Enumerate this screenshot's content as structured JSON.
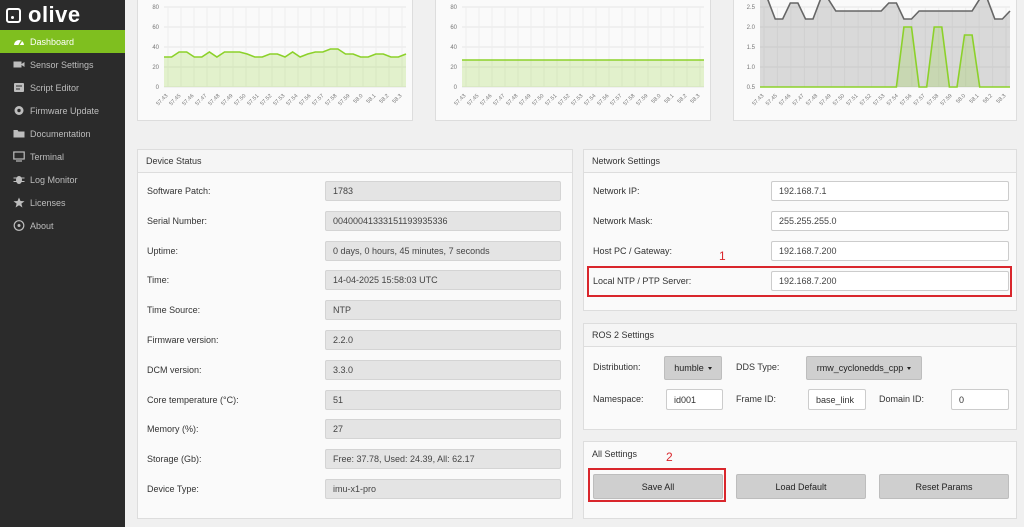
{
  "app": {
    "name": "olive"
  },
  "sidebar": {
    "items": [
      {
        "label": "Dashboard",
        "icon": "dashboard-icon",
        "active": true
      },
      {
        "label": "Sensor Settings",
        "icon": "camera-icon"
      },
      {
        "label": "Script Editor",
        "icon": "script-icon"
      },
      {
        "label": "Firmware Update",
        "icon": "gear-icon"
      },
      {
        "label": "Documentation",
        "icon": "folder-icon"
      },
      {
        "label": "Terminal",
        "icon": "monitor-icon"
      },
      {
        "label": "Log Monitor",
        "icon": "bug-icon"
      },
      {
        "label": "Licenses",
        "icon": "star-icon"
      },
      {
        "label": "About",
        "icon": "info-icon"
      }
    ]
  },
  "chart_data": [
    {
      "type": "area",
      "ylim": [
        0,
        80
      ],
      "yticks": [
        "80",
        "60",
        "40",
        "20",
        "0"
      ],
      "x": [
        "57.43",
        "57.45",
        "57.46",
        "57.47",
        "57.48",
        "57.49",
        "57.50",
        "57.51",
        "57.52",
        "57.53",
        "57.54",
        "57.56",
        "57.57",
        "57.58",
        "57.59",
        "58.0",
        "58.1",
        "58.2",
        "58.3"
      ],
      "series": [
        {
          "values": [
            30,
            30,
            35,
            35,
            30,
            30,
            35,
            30,
            35,
            35,
            35,
            33,
            30,
            30,
            33,
            33,
            30,
            35,
            30,
            33,
            35,
            35,
            38,
            38,
            33,
            33,
            30,
            30,
            33,
            33,
            30,
            30,
            33
          ]
        }
      ],
      "color": "#8cd12a"
    },
    {
      "type": "area",
      "ylim": [
        0,
        80
      ],
      "yticks": [
        "80",
        "60",
        "40",
        "20",
        "0"
      ],
      "x": [
        "57.43",
        "57.45",
        "57.46",
        "57.47",
        "57.48",
        "57.49",
        "57.50",
        "57.51",
        "57.52",
        "57.53",
        "57.54",
        "57.56",
        "57.57",
        "57.58",
        "57.59",
        "58.0",
        "58.1",
        "58.2",
        "58.3"
      ],
      "series": [
        {
          "values": [
            27,
            27
          ]
        }
      ],
      "color": "#8cd12a"
    },
    {
      "type": "area",
      "ylim": [
        0.5,
        2.5
      ],
      "yticks": [
        "2.5",
        "2.0",
        "1.5",
        "1.0",
        "0.5"
      ],
      "x": [
        "57.43",
        "57.45",
        "57.46",
        "57.47",
        "57.48",
        "57.49",
        "57.50",
        "57.51",
        "57.52",
        "57.53",
        "57.54",
        "57.56",
        "57.57",
        "57.58",
        "57.59",
        "58.0",
        "58.1",
        "58.2",
        "58.3"
      ],
      "series": [
        {
          "values": [
            2.7,
            2.7,
            2.2,
            2.2,
            2.6,
            2.6,
            2.2,
            2.2,
            2.7,
            2.7,
            2.4,
            2.4,
            2.4,
            2.4,
            2.4,
            2.4,
            2.4,
            2.6,
            2.6,
            2.2,
            2.2,
            2.4,
            2.4,
            2.4,
            2.4,
            2.4,
            2.4,
            2.4,
            2.4,
            2.7,
            2.7,
            2.2,
            2.2,
            2.4
          ],
          "color": "#666666"
        },
        {
          "values": [
            0.5,
            0.5,
            0.5,
            0.5,
            0.5,
            0.5,
            0.5,
            0.5,
            0.5,
            0.5,
            0.5,
            0.5,
            0.5,
            0.5,
            0.5,
            0.5,
            0.5,
            0.5,
            0.5,
            2.0,
            2.0,
            0.5,
            0.5,
            2.0,
            2.0,
            0.5,
            0.5,
            1.8,
            1.8,
            0.5,
            0.5,
            0.5,
            0.5,
            0.5
          ],
          "color": "#8cd12a"
        }
      ]
    }
  ],
  "device_status": {
    "title": "Device Status",
    "rows": [
      {
        "label": "Software Patch:",
        "value": "1783"
      },
      {
        "label": "Serial Number:",
        "value": "00400041333151193935336"
      },
      {
        "label": "Uptime:",
        "value": "0 days, 0 hours, 45 minutes, 7 seconds"
      },
      {
        "label": "Time:",
        "value": "14-04-2025 15:58:03 UTC"
      },
      {
        "label": "Time Source:",
        "value": "NTP"
      },
      {
        "label": "Firmware version:",
        "value": "2.2.0"
      },
      {
        "label": "DCM version:",
        "value": "3.3.0"
      },
      {
        "label": "Core temperature (°C):",
        "value": "51"
      },
      {
        "label": "Memory (%):",
        "value": "27"
      },
      {
        "label": "Storage (Gb):",
        "value": "Free: 37.78, Used: 24.39, All: 62.17"
      },
      {
        "label": "Device Type:",
        "value": "imu-x1-pro"
      }
    ]
  },
  "network": {
    "title": "Network Settings",
    "rows": [
      {
        "label": "Network IP:",
        "value": "192.168.7.1"
      },
      {
        "label": "Network Mask:",
        "value": "255.255.255.0"
      },
      {
        "label": "Host PC / Gateway:",
        "value": "192.168.7.200"
      },
      {
        "label": "Local NTP / PTP Server:",
        "value": "192.168.7.200"
      }
    ]
  },
  "ros2": {
    "title": "ROS 2 Settings",
    "distribution_label": "Distribution:",
    "distribution_value": "humble",
    "dds_label": "DDS Type:",
    "dds_value": "rmw_cyclonedds_cpp",
    "namespace_label": "Namespace:",
    "namespace_value": "id001",
    "frame_label": "Frame ID:",
    "frame_value": "base_link",
    "domain_label": "Domain ID:",
    "domain_value": "0"
  },
  "all_settings": {
    "title": "All Settings",
    "save_label": "Save All",
    "load_label": "Load Default",
    "reset_label": "Reset Params"
  },
  "annotations": {
    "one": "1",
    "two": "2"
  }
}
